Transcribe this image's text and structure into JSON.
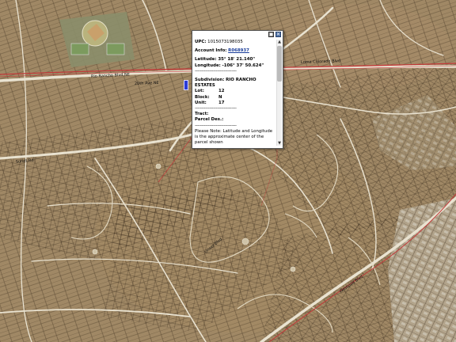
{
  "map": {
    "street_labels": [
      "Rio Rancho Blvd NE",
      "20th Ave NE",
      "Unser Blvd",
      "Westside Blvd",
      "Sundt Rd",
      "Loma Colorado Blvd"
    ],
    "colors": {
      "background": "#a08865",
      "parcel_line": "#2b1f12",
      "street": "#e9e2d0",
      "highway": "#c23a3a"
    }
  },
  "popup": {
    "upc_label": "UPC:",
    "upc_value": "1015073198035",
    "account_label": "Account Info:",
    "account_value": "R068937",
    "latitude_label": "Latitude:",
    "latitude_value": "35° 18' 21.140\"",
    "longitude_label": "Longitude:",
    "longitude_value": "-106° 37' 50.624\"",
    "separator": "--------------------------------",
    "subdivision_label": "Subdivision:",
    "subdivision_value": "RIO RANCHO ESTATES",
    "lot_label": "Lot:",
    "lot_value": "12",
    "block_label": "Block:",
    "block_value": "N",
    "unit_label": "Unit:",
    "unit_value": "17",
    "tract_label": "Tract:",
    "parcel_label": "Parcel Des.:",
    "note": "Please Note: Latitude and Longitude is the approximate center of the parcel shown",
    "minimize_icon": "minimize-icon",
    "close_icon": "close-icon",
    "close_glyph": "✕",
    "minimize_glyph": "□",
    "scroll_up_glyph": "▲",
    "scroll_down_glyph": "▼"
  }
}
